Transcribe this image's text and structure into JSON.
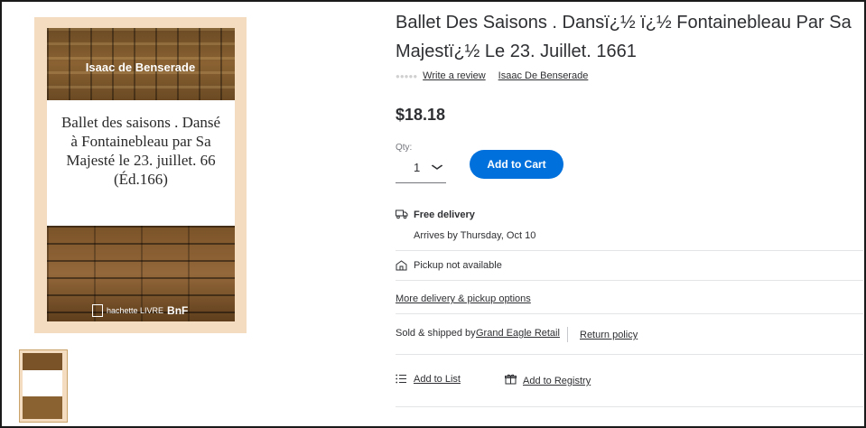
{
  "cover": {
    "author": "Isaac de Benserade",
    "title_lines": [
      "Ballet des saisons . Dansé",
      "à Fontainebleau par Sa",
      "Majesté le 23. juillet. 66",
      "(Éd.166)"
    ],
    "publisher": "hachette LIVRE",
    "library": "BnF"
  },
  "product": {
    "title": "Ballet Des Saisons . Dansï¿½ ï¿½ Fontainebleau Par Sa Majestï¿½ Le 23. Juillet. 1661",
    "write_review": "Write a review",
    "author_link": "Isaac De Benserade",
    "price": "$18.18"
  },
  "qty": {
    "label": "Qty:",
    "value": "1"
  },
  "add_to_cart": "Add to Cart",
  "delivery": {
    "free_delivery": "Free delivery",
    "arrives": "Arrives by Thursday, Oct 10",
    "pickup": "Pickup not available",
    "more_options": "More delivery & pickup options"
  },
  "seller": {
    "sold_by": "Sold & shipped by",
    "seller_name": "Grand Eagle Retail",
    "return_policy": "Return policy"
  },
  "actions": {
    "add_to_list": "Add to List",
    "add_to_registry": "Add to Registry"
  },
  "icons": {
    "truck": "truck-icon",
    "store": "store-icon",
    "list": "list-icon",
    "gift": "gift-icon",
    "chevron": "chevron-down-icon"
  },
  "colors": {
    "primary": "#0071dc",
    "text": "#2e2f32"
  }
}
